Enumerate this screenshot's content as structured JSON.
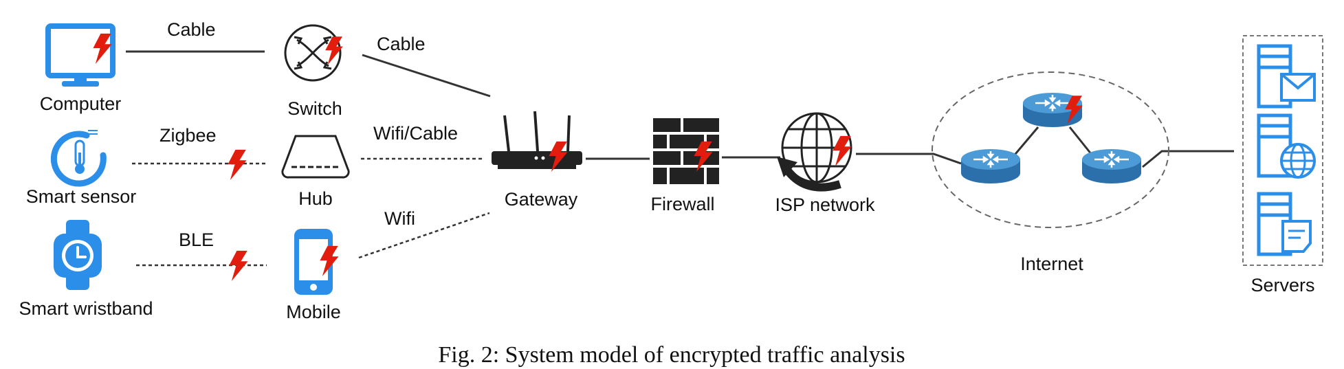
{
  "nodes": {
    "computer": "Computer",
    "switch": "Switch",
    "smart_sensor": "Smart sensor",
    "hub": "Hub",
    "smart_wristband": "Smart wristband",
    "mobile": "Mobile",
    "gateway": "Gateway",
    "firewall": "Firewall",
    "isp": "ISP network",
    "internet": "Internet",
    "servers": "Servers"
  },
  "links": {
    "computer_switch": "Cable",
    "switch_gateway": "Cable",
    "sensor_hub": "Zigbee",
    "hub_gateway": "Wifi/Cable",
    "wristband_mobile": "BLE",
    "mobile_gateway": "Wifi"
  },
  "caption": "Fig. 2: System model of encrypted traffic analysis",
  "colors": {
    "device_blue": "#2b8ee8",
    "router_blue": "#2f7fc1",
    "attack_red": "#e11d0e",
    "line": "#333333",
    "icon_black": "#222222"
  }
}
